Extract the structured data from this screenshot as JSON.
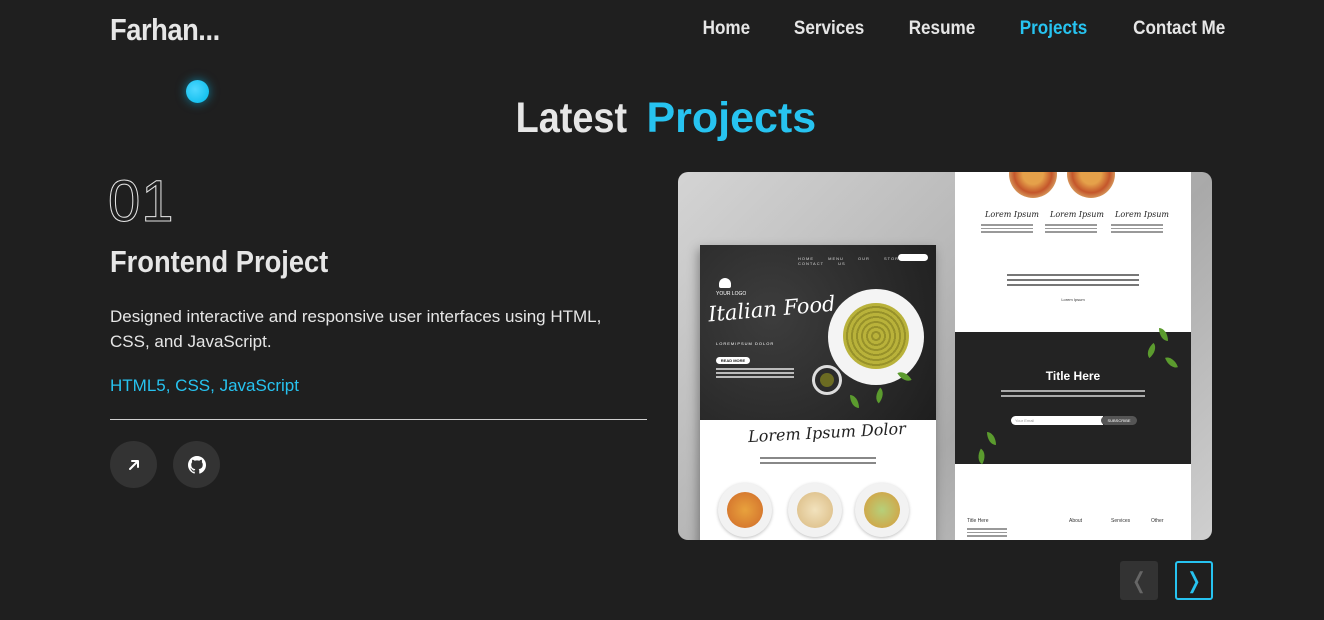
{
  "header": {
    "logo": "Farhan...",
    "nav": [
      {
        "label": "Home",
        "active": false
      },
      {
        "label": "Services",
        "active": false
      },
      {
        "label": "Resume",
        "active": false
      },
      {
        "label": "Projects",
        "active": true
      },
      {
        "label": "Contact Me",
        "active": false
      }
    ]
  },
  "section": {
    "title_white": "Latest",
    "title_accent": "Projects"
  },
  "project": {
    "number": "01",
    "title": "Frontend Project",
    "description": "Designed interactive and responsive user interfaces using HTML, CSS, and JavaScript.",
    "tech": "HTML5, CSS, JavaScript",
    "live_icon": "arrow-up-right-icon",
    "repo_icon": "github-icon"
  },
  "preview": {
    "left_page": {
      "nav": "HOME MENU OUR STORY CONTACT US",
      "logo": "YOUR LOGO",
      "script_title": "Italian Food",
      "subtitle": "LOREMIPSUM DOLOR",
      "button": "READ MORE",
      "section_title": "Lorem Ipsum Dolor"
    },
    "right_page": {
      "signature": "Lorem Ipsum",
      "caption": "Lorem Ipsum",
      "dark_title": "Title Here",
      "email_placeholder": "Your Email",
      "subscribe": "SUBSCRIBE",
      "footer_cols": [
        "Title Here",
        "About",
        "Services",
        "Other"
      ]
    }
  },
  "carousel": {
    "prev": "❬",
    "next": "❭"
  },
  "colors": {
    "background": "#1f1f1f",
    "accent": "#27c3f0",
    "text": "#e6e6e6"
  }
}
